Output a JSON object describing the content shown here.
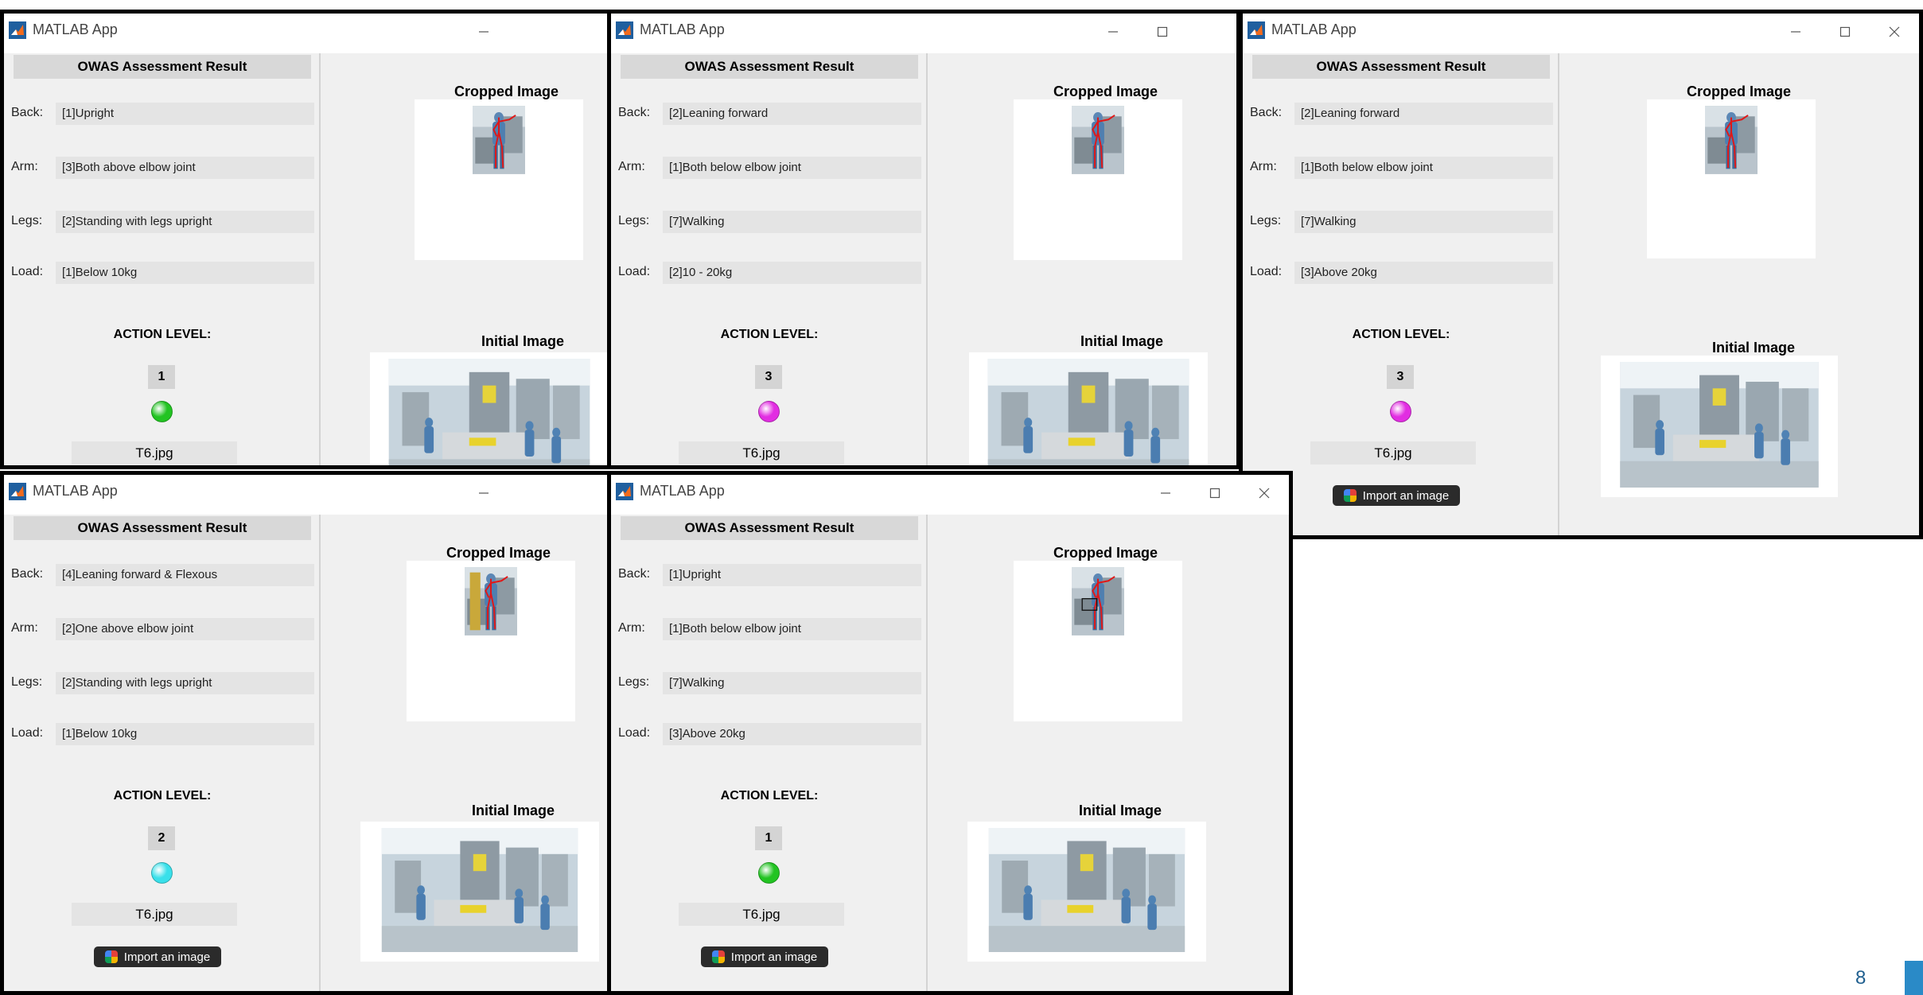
{
  "windows": [
    {
      "id": "w1",
      "title": "MATLAB App",
      "controls": [
        "minimize"
      ],
      "header": "OWAS Assessment Result",
      "fields": [
        {
          "label": "Back:",
          "value": "[1]Upright"
        },
        {
          "label": "Arm:",
          "value": "[3]Both above elbow joint"
        },
        {
          "label": "Legs:",
          "value": "[2]Standing with legs upright"
        },
        {
          "label": "Load:",
          "value": "[1]Below 10kg"
        }
      ],
      "action_label": "ACTION LEVEL:",
      "action_level": "1",
      "lamp_color": "#22c422",
      "file_name": "T6.jpg",
      "import_button": null,
      "cropped_title": "Cropped Image",
      "initial_title": "Initial Image"
    },
    {
      "id": "w2",
      "title": "MATLAB App",
      "controls": [
        "minimize",
        "maximize"
      ],
      "header": "OWAS Assessment Result",
      "fields": [
        {
          "label": "Back:",
          "value": "[2]Leaning forward"
        },
        {
          "label": "Arm:",
          "value": "[1]Both below elbow joint"
        },
        {
          "label": "Legs:",
          "value": "[7]Walking"
        },
        {
          "label": "Load:",
          "value": "[2]10 - 20kg"
        }
      ],
      "action_label": "ACTION LEVEL:",
      "action_level": "3",
      "lamp_color": "#e22de2",
      "file_name": "T6.jpg",
      "import_button": null,
      "cropped_title": "Cropped Image",
      "initial_title": "Initial Image"
    },
    {
      "id": "w3",
      "title": "MATLAB App",
      "controls": [
        "minimize",
        "maximize",
        "close"
      ],
      "header": "OWAS Assessment Result",
      "fields": [
        {
          "label": "Back:",
          "value": "[2]Leaning forward"
        },
        {
          "label": "Arm:",
          "value": "[1]Both below elbow joint"
        },
        {
          "label": "Legs:",
          "value": "[7]Walking"
        },
        {
          "label": "Load:",
          "value": "[3]Above 20kg"
        }
      ],
      "action_label": "ACTION LEVEL:",
      "action_level": "3",
      "lamp_color": "#e22de2",
      "file_name": "T6.jpg",
      "import_button": "Import an image",
      "cropped_title": "Cropped Image",
      "initial_title": "Initial Image"
    },
    {
      "id": "w4",
      "title": "MATLAB App",
      "controls": [
        "minimize"
      ],
      "header": "OWAS Assessment Result",
      "fields": [
        {
          "label": "Back:",
          "value": "[4]Leaning forward & Flexous"
        },
        {
          "label": "Arm:",
          "value": "[2]One above elbow joint"
        },
        {
          "label": "Legs:",
          "value": "[2]Standing with legs upright"
        },
        {
          "label": "Load:",
          "value": "[1]Below 10kg"
        }
      ],
      "action_label": "ACTION LEVEL:",
      "action_level": "2",
      "lamp_color": "#39e0ea",
      "file_name": "T6.jpg",
      "import_button": "Import an image",
      "cropped_title": "Cropped Image",
      "initial_title": "Initial Image"
    },
    {
      "id": "w5",
      "title": "MATLAB App",
      "controls": [
        "minimize",
        "maximize",
        "close"
      ],
      "header": "OWAS Assessment Result",
      "fields": [
        {
          "label": "Back:",
          "value": "[1]Upright"
        },
        {
          "label": "Arm:",
          "value": "[1]Both below elbow joint"
        },
        {
          "label": "Legs:",
          "value": "[7]Walking"
        },
        {
          "label": "Load:",
          "value": "[3]Above 20kg"
        }
      ],
      "action_label": "ACTION LEVEL:",
      "action_level": "1",
      "lamp_color": "#22c422",
      "file_name": "T6.jpg",
      "import_button": "Import an image",
      "cropped_title": "Cropped Image",
      "initial_title": "Initial Image"
    }
  ],
  "slide_number": "8",
  "accent_color": "#2a8ac7"
}
